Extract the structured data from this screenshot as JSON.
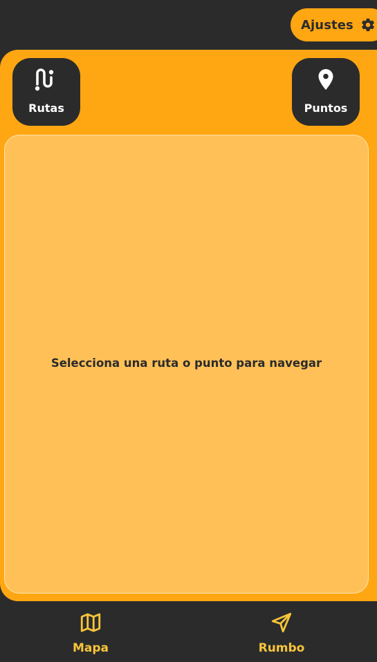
{
  "header": {
    "settings_label": "Ajustes",
    "settings_icon": "gear-icon"
  },
  "tiles": {
    "rutas": {
      "label": "Rutas",
      "icon": "route-icon"
    },
    "puntos": {
      "label": "Puntos",
      "icon": "map-pin-icon"
    }
  },
  "content": {
    "empty_message": "Selecciona una ruta o punto para navegar"
  },
  "bottom_nav": {
    "mapa": {
      "label": "Mapa",
      "icon": "map-icon"
    },
    "rumbo": {
      "label": "Rumbo",
      "icon": "navigation-arrow-icon"
    }
  },
  "colors": {
    "background": "#2b2b2b",
    "accent": "#ffa613",
    "card": "#ffc157",
    "nav_text": "#f8c53a"
  }
}
